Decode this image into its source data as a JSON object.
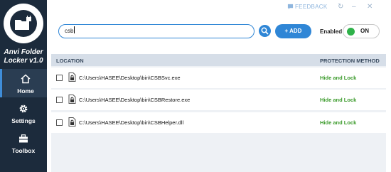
{
  "app": {
    "name_line1": "Anvi Folder",
    "name_line2": "Locker v1.0"
  },
  "sidebar": {
    "items": [
      {
        "label": "Home",
        "icon": "home-icon"
      },
      {
        "label": "Settings",
        "icon": "gear-icon"
      },
      {
        "label": "Toolbox",
        "icon": "toolbox-icon"
      }
    ]
  },
  "topbar": {
    "feedback": "FEEDBACK"
  },
  "search": {
    "value": "csb"
  },
  "toolbar": {
    "add_label": "+ ADD",
    "enabled_label": "Enabled",
    "toggle_label": "ON"
  },
  "table": {
    "headers": {
      "location": "LOCATION",
      "protection": "PROTECTION METHOD"
    },
    "rows": [
      {
        "path": "C:\\Users\\HASEE\\Desktop\\bin\\CSBSvc.exe",
        "method": "Hide and Lock"
      },
      {
        "path": "C:\\Users\\HASEE\\Desktop\\bin\\CSBRestore.exe",
        "method": "Hide and Lock"
      },
      {
        "path": "C:\\Users\\HASEE\\Desktop\\bin\\CSBHelper.dll",
        "method": "Hide and Lock"
      }
    ]
  },
  "colors": {
    "sidebar": "#1c2b3c",
    "accent": "#2f86d6",
    "method_green": "#3a9a2a",
    "toggle_green": "#2fb24a"
  }
}
